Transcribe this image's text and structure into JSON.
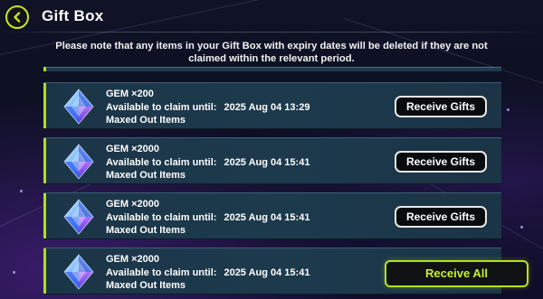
{
  "header": {
    "title": "Gift Box",
    "back_icon": "chevron-left-icon"
  },
  "notice": "Please note that any items in your Gift Box with expiry dates will be deleted if they are not claimed within the relevant period.",
  "gifts": [
    {
      "item": "GEM ×200",
      "claim_label": "Available to claim until:",
      "date": "2025 Aug 04 13:29",
      "status": "Maxed Out Items",
      "button": "Receive Gifts",
      "icon": "gem-icon"
    },
    {
      "item": "GEM ×2000",
      "claim_label": "Available to claim until:",
      "date": "2025 Aug 04 15:41",
      "status": "Maxed Out Items",
      "button": "Receive Gifts",
      "icon": "gem-icon"
    },
    {
      "item": "GEM ×2000",
      "claim_label": "Available to claim until:",
      "date": "2025 Aug 04 15:41",
      "status": "Maxed Out Items",
      "button": "Receive Gifts",
      "icon": "gem-icon"
    },
    {
      "item": "GEM ×2000",
      "claim_label": "Available to claim until:",
      "date": "2025 Aug 04 15:41",
      "status": "Maxed Out Items",
      "icon": "gem-icon"
    }
  ],
  "receive_all": "Receive All",
  "colors": {
    "accent": "#b4dc1e",
    "row_bg": "#1c3749",
    "background": "#0f1124"
  }
}
